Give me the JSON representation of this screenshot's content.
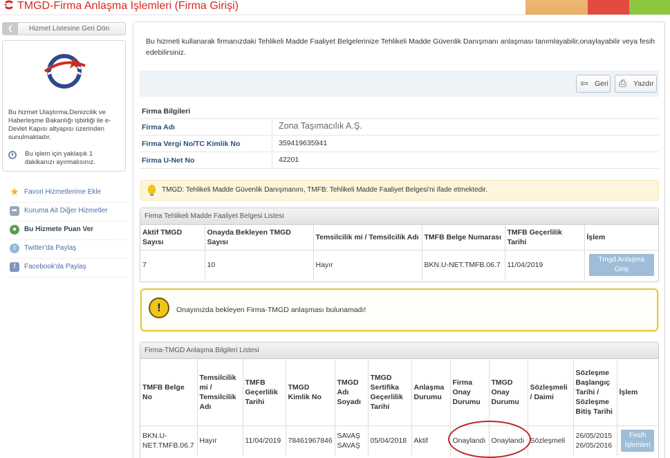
{
  "header": {
    "title": "TMGD-Firma Anlaşma İşlemleri (Firma Girişi)"
  },
  "sidebar": {
    "back_label": "Hizmet Listesine Geri Dön",
    "info_text": "Bu hizmet Ulaştırma,Denizcilik ve Haberleşme Bakanlığı işbirliği ile e-Devlet Kapısı altyapısı üzerinden sunulmaktadır.",
    "time_text": "Bu işlem için yaklaşık 1 dakikanızı ayırmalısınız.",
    "links": [
      {
        "label": "Favori Hizmetlerime Ekle",
        "icon": "star-icon",
        "bold": false
      },
      {
        "label": "Kuruma Ait Diğer Hizmetler",
        "icon": "share-icon",
        "bold": false
      },
      {
        "label": "Bu Hizmete Puan Ver",
        "icon": "rate-icon",
        "bold": true
      },
      {
        "label": "Twitter'da Paylaş",
        "icon": "twitter-icon",
        "bold": false
      },
      {
        "label": "Facebook'da Paylaş",
        "icon": "facebook-icon",
        "bold": false
      }
    ]
  },
  "main": {
    "intro": "Bu hizmeti kullanarak firmanızdaki Tehlikeli Madde Faaliyet Belgelerinize Tehlikeli Madde Güvenlik Danışmanı anlaşması tanımlayabilir,onaylayabilir veya fesih edebilirsiniz.",
    "toolbar": {
      "back_label": "Geri",
      "print_label": "Yazdır"
    },
    "firm_info": {
      "title": "Firma Bilgileri",
      "rows": [
        {
          "label": "Firma Adı",
          "value": "Zona Taşımacılık A.Ş."
        },
        {
          "label": "Firma Vergi No/TC Kimlik No",
          "value": "359419635941"
        },
        {
          "label": "Firma U-Net No",
          "value": "42201"
        }
      ]
    },
    "note": "TMGD: Tehlikeli Madde Güvenlik Danışmanını, TMFB: Tehlikeli Madde Faaliyet Belgesi'ni ifade etmektedir.",
    "certificate_list": {
      "title": "Firma Tehlikeli Madde Faaliyet Belgesi Listesi",
      "headers": [
        "Aktif TMGD Sayısı",
        "Onayda Bekleyen TMGD Sayısı",
        "Temsilcilik mi / Temsilcilik Adı",
        "TMFB Belge Numarası",
        "TMFB Geçerlilik Tarihi",
        "İşlem"
      ],
      "rows": [
        {
          "aktif": "7",
          "bekleyen": "10",
          "temsilcilik": "Hayır",
          "belge_no": "BKN.U-NET.TMFB.06.7",
          "gecerlilik": "11/04/2019",
          "action": "Tmgd Anlaşma Giriş"
        }
      ]
    },
    "warning": "Onayınızda bekleyen Firma-TMGD anlaşması bulunamadı!",
    "agreement_list": {
      "title": "Firma-TMGD Anlaşma Bilgileri Listesi",
      "headers": [
        "TMFB Belge No",
        "Temsilcilik mi / Temsilcilik Adı",
        "TMFB Geçerlilik Tarihi",
        "TMGD Kimlik No",
        "TMGD Adı Soyadı",
        "TMGD Sertifika Geçerlilik Tarihi",
        "Anlaşma Durumu",
        "Firma Onay Durumu",
        "TMGD Onay Durumu",
        "Sözleşmeli / Daimi",
        "Sözleşme Başlangıç Tarihi / Sözleşme Bitiş Tarihi",
        "İşlem"
      ],
      "rows": [
        {
          "belge_no": "BKN.U-NET.TMFB.06.7",
          "temsilcilik": "Hayır",
          "gecerlilik": "11/04/2019",
          "kimlik_no": "78461967846",
          "ad": "SAVAŞ",
          "soyad": "SAVAŞ",
          "sertifika": "05/04/2018",
          "durum": "Aktif",
          "firma_onay": "Onaylandı",
          "tmgd_onay": "Onaylandı",
          "tip": "Sözleşmeli",
          "baslangic": "26/05/2015",
          "bitis": "26/05/2016",
          "action": "Fesih İşlemleri"
        }
      ]
    }
  },
  "colors": {
    "title_red": "#d22b1f",
    "link_blue": "#2a4e7a",
    "button_blue": "#9dbdd8",
    "warning_border": "#e5c93a",
    "highlight_oval": "#b8252b"
  }
}
